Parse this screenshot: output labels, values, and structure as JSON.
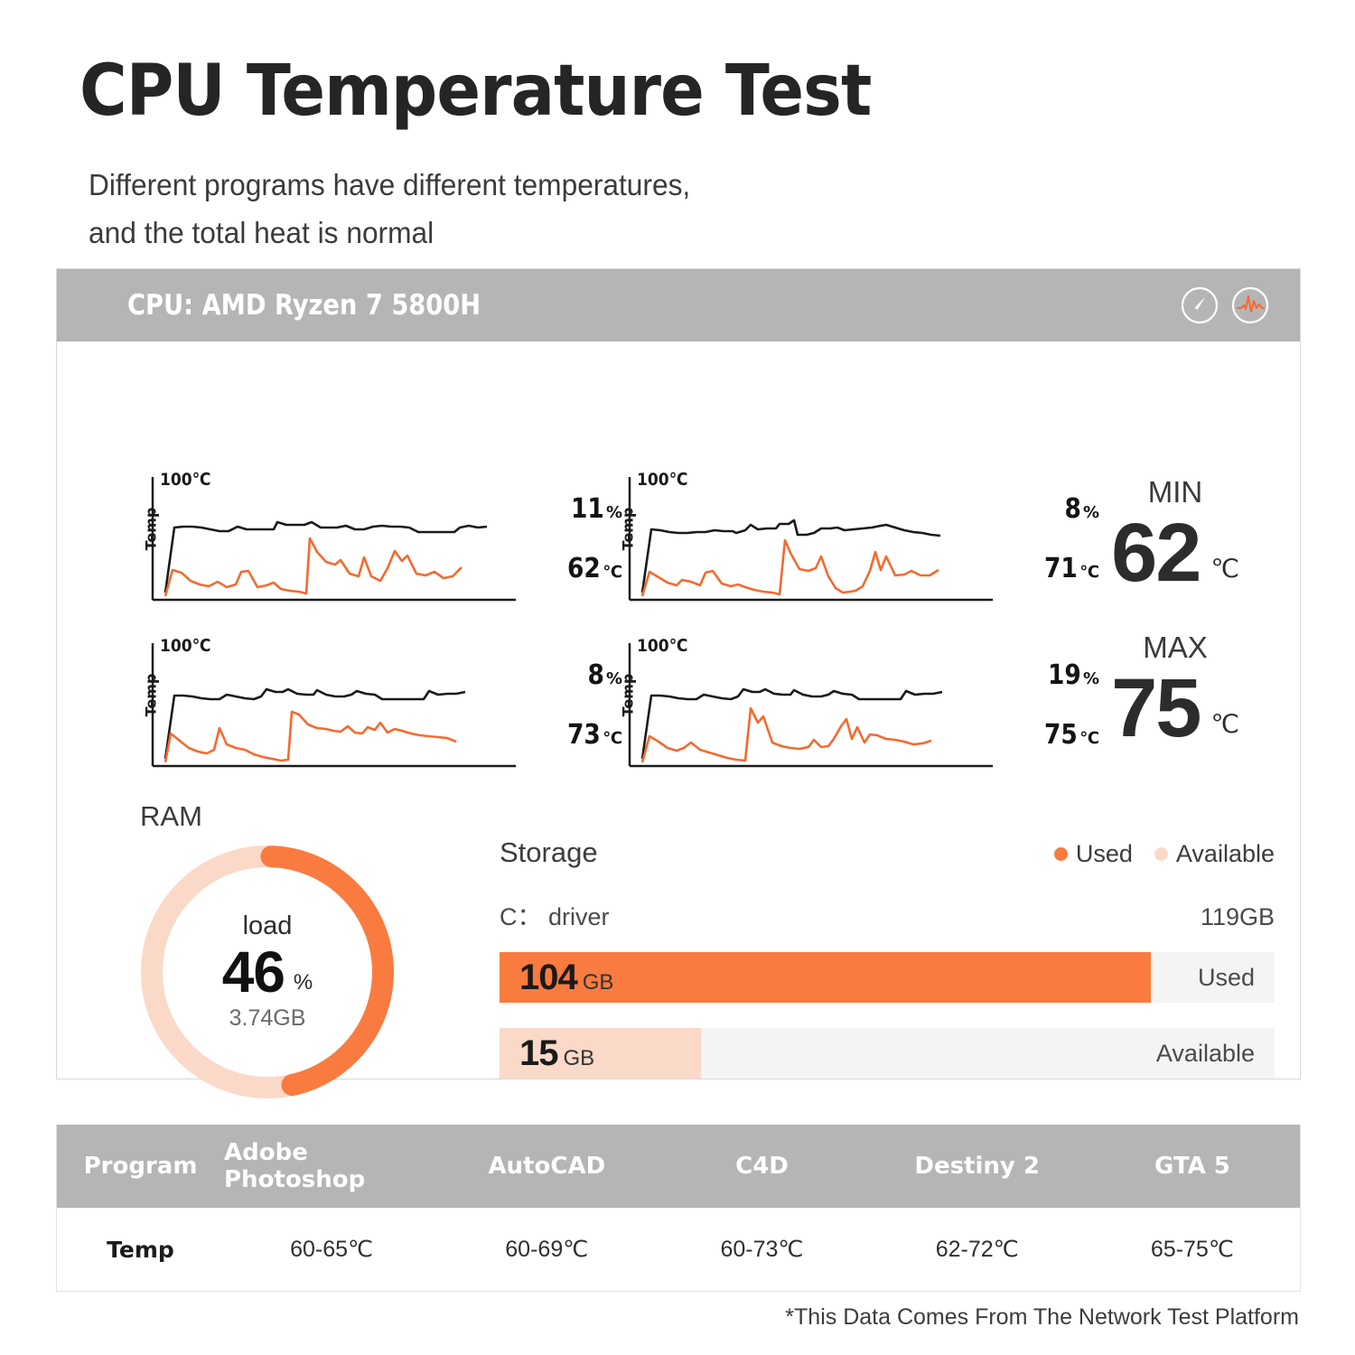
{
  "header": {
    "title": "CPU Temperature Test",
    "subtitle_line1": "Different programs have different temperatures,",
    "subtitle_line2": "and the total heat is normal"
  },
  "panel": {
    "cpu_label": "CPU: AMD Ryzen 7 5800H",
    "icons": [
      "speedometer-icon",
      "pulse-wave-icon"
    ]
  },
  "colors": {
    "accent_orange": "#F97B40",
    "light_peach": "#FBD9C8",
    "header_gray": "#B5B5B5",
    "track_gray": "#F4F4F4",
    "line_black": "#1A1A1A"
  },
  "charts": [
    {
      "axis_top": "100℃",
      "ylabel": "Temp",
      "percent": "11",
      "percent_unit": "%",
      "temp": "62",
      "temp_unit": "℃"
    },
    {
      "axis_top": "100℃",
      "ylabel": "Temp",
      "percent": "8",
      "percent_unit": "%",
      "temp": "71",
      "temp_unit": "℃"
    },
    {
      "axis_top": "100℃",
      "ylabel": "Temp",
      "percent": "8",
      "percent_unit": "%",
      "temp": "73",
      "temp_unit": "℃"
    },
    {
      "axis_top": "100℃",
      "ylabel": "Temp",
      "percent": "19",
      "percent_unit": "%",
      "temp": "75",
      "temp_unit": "℃"
    }
  ],
  "minmax": {
    "min_label": "MIN",
    "min_value": "62",
    "min_unit": "℃",
    "max_label": "MAX",
    "max_value": "75",
    "max_unit": "℃"
  },
  "ram": {
    "section_label": "RAM",
    "center_label": "load",
    "percent": "46",
    "percent_unit": "%",
    "amount": "3.74GB",
    "percent_value": 46
  },
  "storage": {
    "section_label": "Storage",
    "legend": [
      {
        "label": "Used",
        "color": "#F97B40"
      },
      {
        "label": "Available",
        "color": "#FBD9C8"
      }
    ],
    "drive_name": "C： driver",
    "drive_total": "119GB",
    "bars": [
      {
        "value": "104",
        "unit": "GB",
        "tag": "Used",
        "fill_percent": 84,
        "color": "#F97B40"
      },
      {
        "value": "15",
        "unit": "GB",
        "tag": "Available",
        "fill_percent": 26,
        "color": "#FBD9C8"
      }
    ]
  },
  "table": {
    "headers": [
      "Program",
      "Adobe Photoshop",
      "AutoCAD",
      "C4D",
      "Destiny 2",
      "GTA 5"
    ],
    "rows": [
      [
        "Temp",
        "60-65℃",
        "60-69℃",
        "60-73℃",
        "62-72℃",
        "65-75℃"
      ]
    ]
  },
  "footnote": "*This Data Comes From The Network Test Platform",
  "chart_data": {
    "type": "line",
    "title": "CPU Temperature Test",
    "ylabel": "Temp",
    "ylim": [
      0,
      100
    ],
    "axis_top_label": "100℃",
    "panels": [
      {
        "name": "chart-1",
        "percent": 11,
        "temp": 62,
        "series": [
          {
            "name": "temperature",
            "color": "#1A1A1A",
            "values": [
              4,
              62,
              63,
              63,
              62,
              61,
              60,
              60,
              63,
              61,
              61,
              61,
              61,
              67,
              64,
              64,
              64,
              66,
              62,
              62,
              62,
              63,
              61,
              61,
              63,
              64,
              63,
              63,
              62,
              59,
              59,
              59,
              59,
              59,
              62,
              63,
              62,
              63
            ]
          },
          {
            "name": "load",
            "color": "#F26B30",
            "values": [
              2,
              24,
              22,
              16,
              13,
              12,
              15,
              11,
              13,
              22,
              23,
              10,
              11,
              13,
              9,
              8,
              7,
              6,
              46,
              36,
              29,
              27,
              30,
              20,
              18,
              31,
              18,
              15,
              23,
              36,
              28,
              32,
              20,
              19,
              21,
              17,
              18,
              24
            ]
          }
        ]
      },
      {
        "name": "chart-2",
        "percent": 8,
        "temp": 71,
        "series": [
          {
            "name": "temperature",
            "color": "#1A1A1A",
            "values": [
              4,
              62,
              61,
              60,
              59,
              59,
              60,
              60,
              61,
              60,
              60,
              60,
              61,
              64,
              61,
              62,
              63,
              62,
              62,
              64,
              68,
              55,
              55,
              57,
              59,
              58,
              57,
              59,
              57,
              58,
              58,
              59,
              60,
              61,
              59,
              57,
              55,
              54
            ]
          },
          {
            "name": "load",
            "color": "#F26B30",
            "values": [
              2,
              22,
              18,
              14,
              12,
              15,
              14,
              12,
              20,
              21,
              12,
              10,
              11,
              12,
              10,
              8,
              7,
              6,
              42,
              22,
              19,
              19,
              24,
              13,
              6,
              3,
              3,
              4,
              9,
              16,
              28,
              19,
              26,
              22,
              14,
              13,
              15,
              17
            ]
          }
        ]
      },
      {
        "name": "chart-3",
        "percent": 8,
        "temp": 73,
        "series": [
          {
            "name": "temperature",
            "color": "#1A1A1A",
            "values": [
              4,
              62,
              62,
              61,
              60,
              59,
              59,
              62,
              61,
              60,
              59,
              61,
              66,
              63,
              63,
              66,
              62,
              61,
              61,
              64,
              61,
              60,
              60,
              61,
              64,
              62,
              61,
              57,
              57,
              57,
              57,
              57,
              57,
              63,
              60,
              61,
              61,
              62
            ]
          },
          {
            "name": "load",
            "color": "#F26B30",
            "values": [
              2,
              26,
              21,
              15,
              12,
              11,
              13,
              22,
              14,
              12,
              11,
              8,
              6,
              5,
              4,
              3,
              38,
              36,
              29,
              25,
              24,
              23,
              22,
              26,
              21,
              20,
              25,
              23,
              27,
              21,
              24,
              23,
              20,
              19,
              18,
              18,
              17,
              15
            ]
          }
        ]
      },
      {
        "name": "chart-4",
        "percent": 19,
        "temp": 75,
        "series": [
          {
            "name": "temperature",
            "color": "#1A1A1A",
            "values": [
              4,
              62,
              62,
              61,
              60,
              59,
              59,
              62,
              61,
              60,
              59,
              61,
              66,
              63,
              63,
              66,
              62,
              61,
              61,
              64,
              61,
              60,
              60,
              61,
              64,
              62,
              61,
              57,
              57,
              57,
              57,
              57,
              57,
              63,
              60,
              61,
              61,
              62
            ]
          },
          {
            "name": "load",
            "color": "#F26B30",
            "values": [
              2,
              24,
              20,
              15,
              13,
              15,
              18,
              13,
              10,
              9,
              7,
              5,
              4,
              44,
              36,
              38,
              18,
              14,
              13,
              12,
              13,
              18,
              13,
              14,
              18,
              26,
              32,
              20,
              26,
              16,
              22,
              21,
              17,
              16,
              15,
              13,
              14,
              16
            ]
          }
        ]
      }
    ]
  }
}
